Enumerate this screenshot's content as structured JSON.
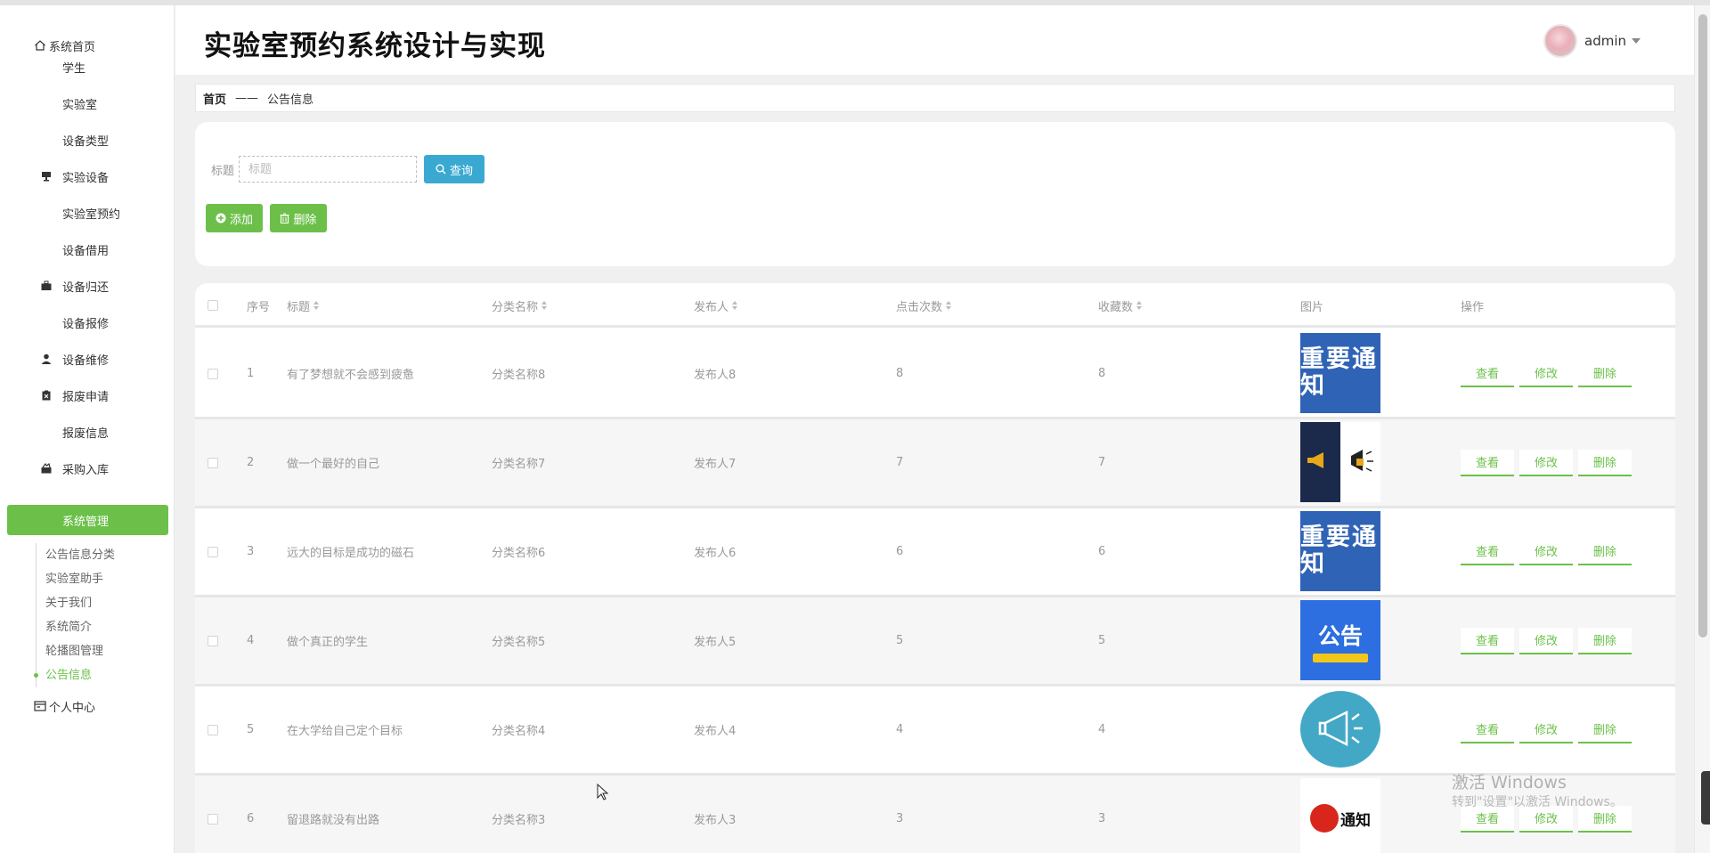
{
  "header": {
    "title": "实验室预约系统设计与实现",
    "username": "admin"
  },
  "sidebar": {
    "home": "系统首页",
    "items": [
      {
        "label": "学生",
        "icon": "grid-icon"
      },
      {
        "label": "实验室",
        "icon": "grid-icon"
      },
      {
        "label": "设备类型",
        "icon": "grid-icon"
      },
      {
        "label": "实验设备",
        "icon": "monitor-icon"
      },
      {
        "label": "实验室预约",
        "icon": "grid-icon"
      },
      {
        "label": "设备借用",
        "icon": "grid-icon"
      },
      {
        "label": "设备归还",
        "icon": "briefcase-icon"
      },
      {
        "label": "设备报修",
        "icon": "grid-icon"
      },
      {
        "label": "设备维修",
        "icon": "user-icon"
      },
      {
        "label": "报废申请",
        "icon": "clipboard-icon"
      },
      {
        "label": "报废信息",
        "icon": "grid-icon"
      },
      {
        "label": "采购入库",
        "icon": "cart-icon"
      },
      {
        "label": "系统管理",
        "icon": "grid-icon"
      }
    ],
    "submenu": [
      "公告信息分类",
      "实验室助手",
      "关于我们",
      "系统简介",
      "轮播图管理",
      "公告信息"
    ],
    "personal": "个人中心"
  },
  "breadcrumb": {
    "home": "首页",
    "sep": "——",
    "current": "公告信息"
  },
  "search": {
    "label": "标题",
    "placeholder": "标题",
    "query_label": "查询",
    "add_label": "添加",
    "delete_label": "删除"
  },
  "table": {
    "headers": {
      "index": "序号",
      "title": "标题",
      "category": "分类名称",
      "publisher": "发布人",
      "clicks": "点击次数",
      "favorites": "收藏数",
      "image": "图片",
      "actions": "操作"
    },
    "rows": [
      {
        "index": "1",
        "title": "有了梦想就不会感到疲惫",
        "category": "分类名称8",
        "publisher": "发布人8",
        "clicks": "8",
        "favorites": "8",
        "image": "重要通知",
        "image_type": "notice"
      },
      {
        "index": "2",
        "title": "做一个最好的自己",
        "category": "分类名称7",
        "publisher": "发布人7",
        "clicks": "7",
        "favorites": "7",
        "image": "",
        "image_type": "horn"
      },
      {
        "index": "3",
        "title": "远大的目标是成功的磁石",
        "category": "分类名称6",
        "publisher": "发布人6",
        "clicks": "6",
        "favorites": "6",
        "image": "重要通知",
        "image_type": "notice"
      },
      {
        "index": "4",
        "title": "做个真正的学生",
        "category": "分类名称5",
        "publisher": "发布人5",
        "clicks": "5",
        "favorites": "5",
        "image": "公告",
        "image_type": "announcement"
      },
      {
        "index": "5",
        "title": "在大学给自己定个目标",
        "category": "分类名称4",
        "publisher": "发布人4",
        "clicks": "4",
        "favorites": "4",
        "image": "",
        "image_type": "bubble"
      },
      {
        "index": "6",
        "title": "留退路就没有出路",
        "category": "分类名称3",
        "publisher": "发布人3",
        "clicks": "3",
        "favorites": "3",
        "image": "通知",
        "image_type": "red"
      }
    ],
    "actions": {
      "view": "查看",
      "edit": "修改",
      "delete": "删除"
    }
  },
  "watermark": {
    "line1": "激活 Windows",
    "line2": "转到\"设置\"以激活 Windows。"
  },
  "colors": {
    "accent": "#6cc04a",
    "query_button": "#3aa9d1"
  }
}
